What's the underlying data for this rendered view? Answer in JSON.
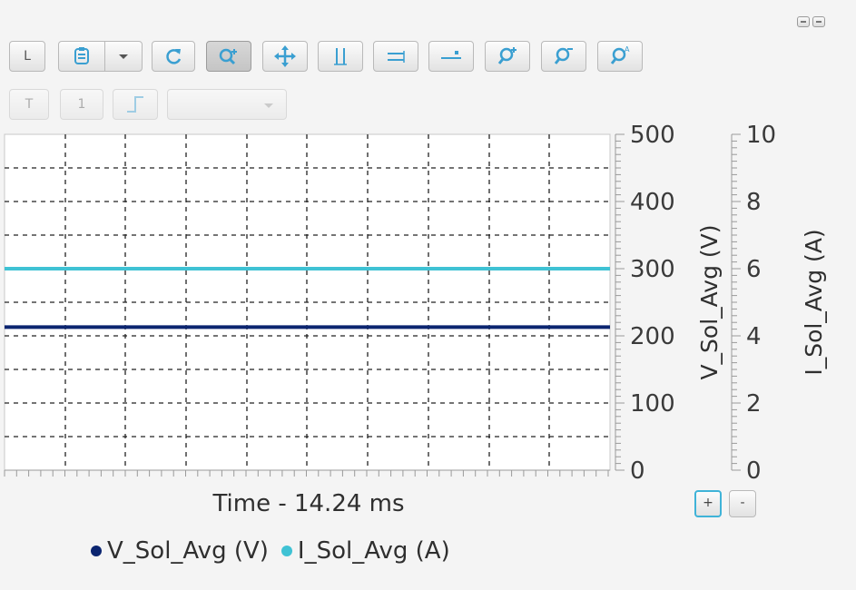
{
  "window": {
    "buttons": [
      "minimize-icon",
      "restore-icon"
    ]
  },
  "toolbar": {
    "row1": [
      {
        "name": "legend-toggle-button",
        "label": "L",
        "icon": "text"
      },
      {
        "name": "save-button",
        "icon": "save-icon"
      },
      {
        "name": "save-dropdown-button",
        "icon": "chevron-down-icon"
      },
      {
        "name": "refresh-button",
        "icon": "refresh-icon"
      },
      {
        "name": "zoom-mode-button",
        "icon": "zoom-plus-icon",
        "pressed": true
      },
      {
        "name": "pan-button",
        "icon": "move-icon"
      },
      {
        "name": "fit-vertical-button",
        "icon": "vertical-bars-icon"
      },
      {
        "name": "fit-horizontal-button",
        "icon": "horizontal-bars-icon"
      },
      {
        "name": "cursor-button",
        "icon": "cursor-line-icon"
      },
      {
        "name": "zoom-in-button",
        "icon": "zoom-in-icon"
      },
      {
        "name": "zoom-out-button",
        "icon": "zoom-out-icon"
      },
      {
        "name": "zoom-reset-button",
        "icon": "zoom-reset-icon"
      }
    ],
    "row2": [
      {
        "name": "t-button",
        "label": "T",
        "disabled": true
      },
      {
        "name": "one-button",
        "label": "1",
        "disabled": true
      },
      {
        "name": "step-button",
        "icon": "step-icon",
        "disabled": true
      }
    ],
    "combo_value": ""
  },
  "x_axis_label": "Time - 14.24 ms",
  "zoom_buttons": {
    "plus": "+",
    "minus": "-"
  },
  "colors": {
    "v_series": "#0b2570",
    "i_series": "#3fc2d4",
    "grid": "#222222"
  },
  "chart_data": {
    "type": "line",
    "xlabel": "Time - 14.24 ms",
    "y_axes": [
      {
        "label": "V_Sol_Avg (V)",
        "lim": [
          0,
          500
        ],
        "ticks": [
          "0",
          "100",
          "200",
          "300",
          "400",
          "500"
        ]
      },
      {
        "label": "I_Sol_Avg (A)",
        "lim": [
          0,
          10
        ],
        "ticks": [
          "0",
          "2",
          "4",
          "6",
          "8",
          "10"
        ]
      }
    ],
    "grid": true,
    "legend_position": "bottom",
    "series": [
      {
        "name": "V_Sol_Avg (V)",
        "axis": 0,
        "color": "#0b2570",
        "values": [
          213,
          213
        ]
      },
      {
        "name": "I_Sol_Avg (A)",
        "axis": 1,
        "color": "#3fc2d4",
        "values": [
          6.0,
          6.0
        ]
      }
    ]
  }
}
